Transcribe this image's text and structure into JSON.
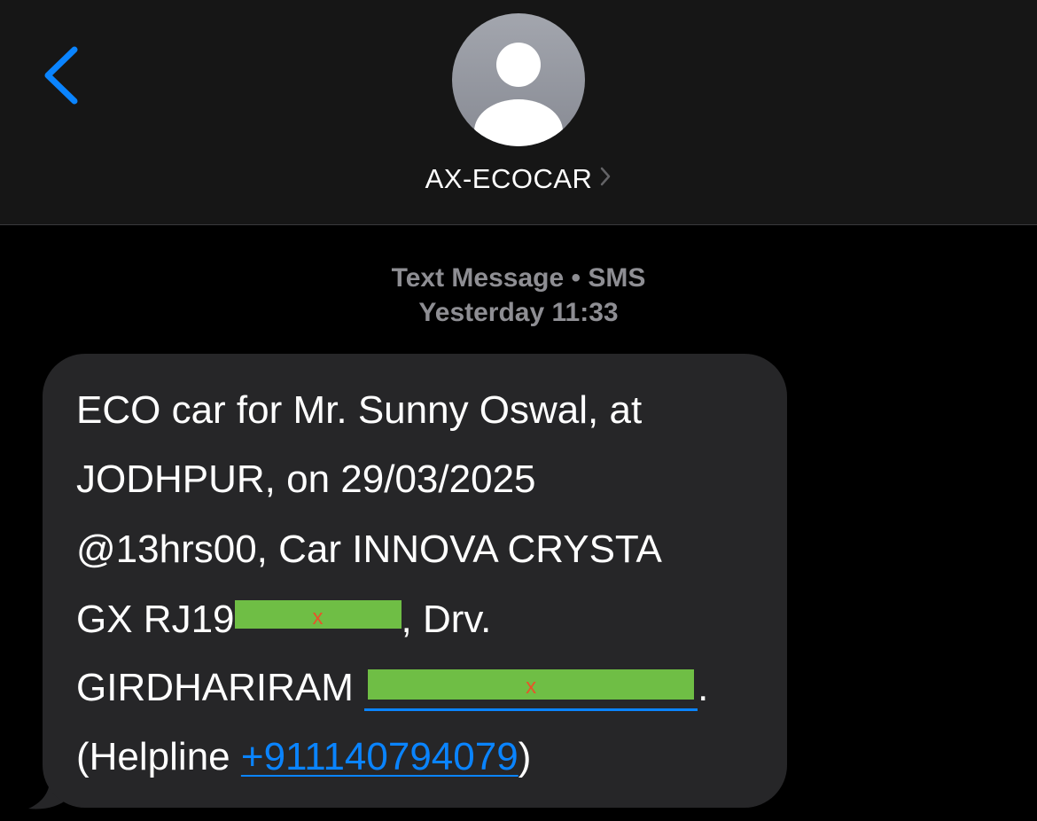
{
  "header": {
    "contact_name": "AX-ECOCAR",
    "icons": {
      "back": "chevron-left-icon",
      "avatar": "person-icon",
      "contact_chevron": "chevron-right-icon"
    }
  },
  "meta": {
    "service": "Text Message • SMS",
    "timestamp": "Yesterday 11:33"
  },
  "message": {
    "line1": "ECO car for Mr. Sunny Oswal, at",
    "line2": "JODHPUR, on 29/03/2025",
    "line3": "@13hrs00, Car INNOVA CRYSTA",
    "line4_prefix": "GX RJ19",
    "line4_redaction_mark": "x",
    "line4_suffix": ", Drv.",
    "line5_prefix": "GIRDHARIRAM ",
    "line5_redaction_mark": "x",
    "line5_suffix": ".",
    "line6_prefix": "(Helpline ",
    "helpline_number": "+911140794079",
    "line6_suffix": ")"
  },
  "colors": {
    "accent": "#0a84ff",
    "bubble": "#262628",
    "header_bg": "#161616",
    "redaction": "#6fbe45",
    "redaction_mark": "#e8542a"
  }
}
